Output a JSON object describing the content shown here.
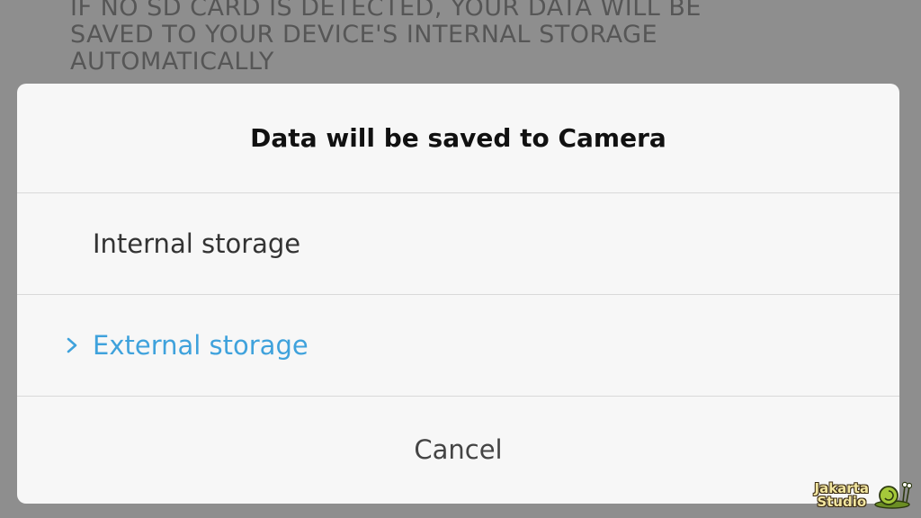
{
  "background_notice": {
    "lines": [
      "IF NO SD CARD IS DETECTED, YOUR DATA WILL BE",
      "SAVED TO YOUR DEVICE'S INTERNAL STORAGE",
      "AUTOMATICALLY"
    ]
  },
  "dialog": {
    "title": "Data will be saved to Camera",
    "options": [
      {
        "label": "Internal storage",
        "selected": false
      },
      {
        "label": "External storage",
        "selected": true
      }
    ],
    "cancel_label": "Cancel"
  },
  "watermark": {
    "line1": "Jakarta",
    "line2": "Studio"
  },
  "colors": {
    "accent": "#3fa2dc",
    "dialog_bg": "#f7f7f7",
    "overlay": "#8e8e8e"
  },
  "icons": {
    "selected_indicator": "chevron-right-icon",
    "watermark_logo": "snail-logo-icon"
  }
}
